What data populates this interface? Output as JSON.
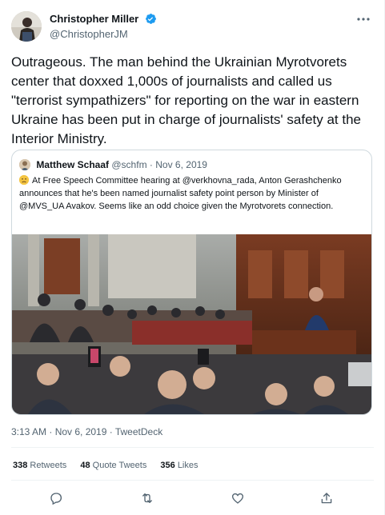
{
  "author": {
    "display_name": "Christopher Miller",
    "handle": "@ChristopherJM",
    "verified": true
  },
  "tweet": {
    "text": "Outrageous. The man behind the Ukrainian Myrotvorets center that doxxed 1,000s of journalists and called us \"terrorist sympathizers\" for reporting on the war in eastern Ukraine has been put in charge of journalists' safety at the Interior Ministry."
  },
  "quote": {
    "display_name": "Matthew Schaaf",
    "handle": "@schfm",
    "separator": "·",
    "date": "Nov 6, 2019",
    "emoji": "slightly-frowning-face",
    "text": "At Free Speech Committee hearing at @verkhovna_rada, Anton Gerashchenko announces that he's been named journalist safety point person by Minister of @MVS_UA Avakov. Seems like an odd choice given the Myrotvorets connection."
  },
  "meta": {
    "timestamp": "3:13 AM · Nov 6, 2019 · TweetDeck"
  },
  "stats": {
    "retweets_count": "338",
    "retweets_label": "Retweets",
    "quote_tweets_count": "48",
    "quote_tweets_label": "Quote Tweets",
    "likes_count": "356",
    "likes_label": "Likes"
  },
  "actions": [
    "reply-icon",
    "retweet-icon",
    "like-icon",
    "share-icon"
  ],
  "colors": {
    "verified": "#1d9bf0",
    "secondary_text": "#536471",
    "border": "#cfd9de",
    "divider": "#eff3f4",
    "action_icon": "#536471"
  }
}
